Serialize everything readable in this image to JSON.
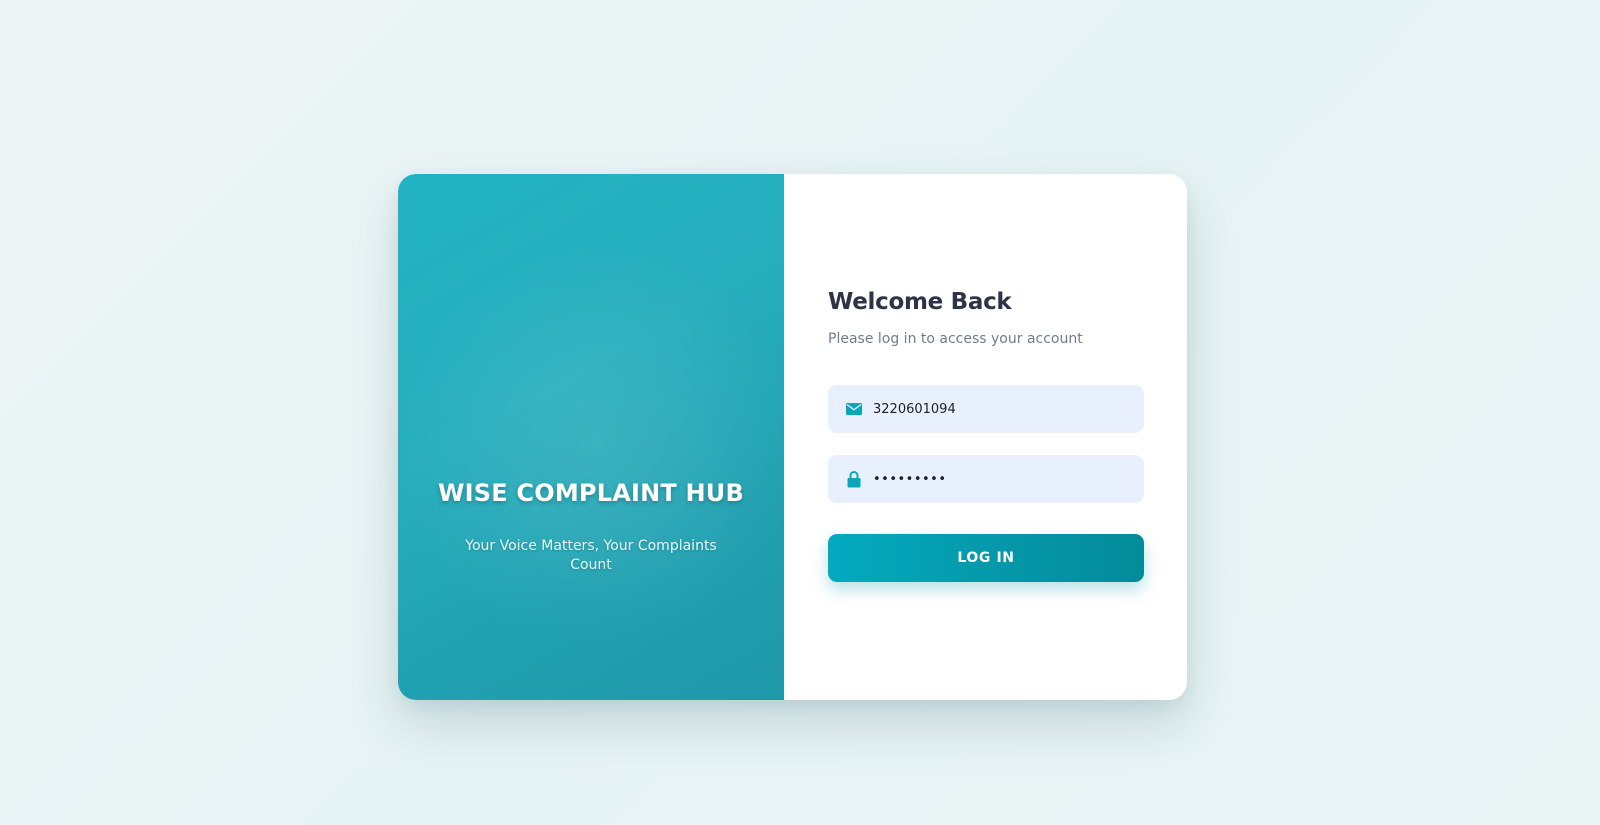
{
  "brand": {
    "title": "WISE COMPLAINT HUB",
    "tagline": "Your Voice Matters, Your Complaints Count"
  },
  "login": {
    "title": "Welcome Back",
    "subtitle": "Please log in to access your account",
    "email_field": {
      "value": "3220601094",
      "icon": "envelope-icon"
    },
    "password_field": {
      "value": "•••••••••",
      "icon": "lock-icon"
    },
    "button_label": "LOG IN"
  },
  "colors": {
    "accent": "#06a9bd",
    "brand_panel": "#23aebe",
    "input_bg": "#e8f0fd",
    "title_text": "#2d3447"
  }
}
